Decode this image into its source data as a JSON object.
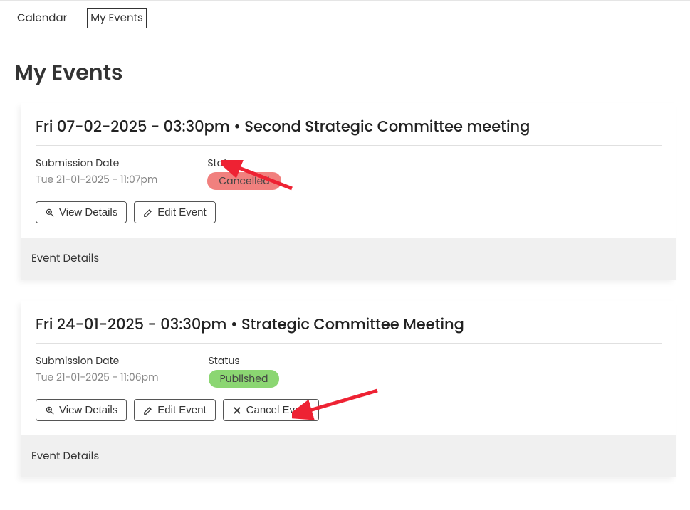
{
  "tabs": {
    "calendar": "Calendar",
    "my_events": "My Events"
  },
  "page_title": "My Events",
  "events": [
    {
      "title": "Fri 07-02-2025 - 03:30pm • Second Strategic Committee meeting",
      "submission_label": "Submission Date",
      "submission_value": "Tue 21-01-2025 - 11:07pm",
      "status_label": "Status",
      "status_value": "Cancelled",
      "status_kind": "cancelled",
      "view_label": "View Details",
      "edit_label": "Edit Event",
      "details_header": "Event Details"
    },
    {
      "title": "Fri 24-01-2025 - 03:30pm • Strategic Committee Meeting",
      "submission_label": "Submission Date",
      "submission_value": "Tue 21-01-2025 - 11:06pm",
      "status_label": "Status",
      "status_value": "Published",
      "status_kind": "published",
      "view_label": "View Details",
      "edit_label": "Edit Event",
      "cancel_label": "Cancel Event",
      "details_header": "Event Details"
    }
  ]
}
